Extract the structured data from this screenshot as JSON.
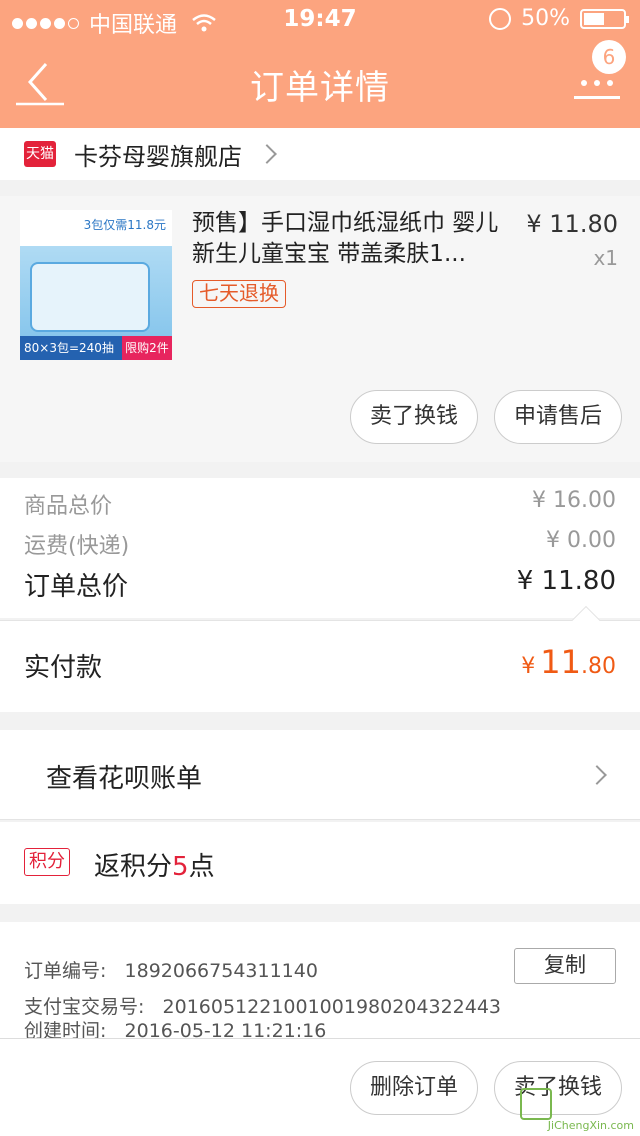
{
  "status_bar": {
    "carrier": "中国联通",
    "time": "19:47",
    "battery": "50%"
  },
  "nav": {
    "title": "订单详情",
    "badge": "6"
  },
  "store": {
    "platform_badge": "天猫",
    "name": "卡芬母婴旗舰店"
  },
  "product": {
    "title": "预售】手口湿巾纸湿纸巾 婴儿新生儿童宝宝 带盖柔肤1...",
    "price": "¥ 11.80",
    "quantity": "x1",
    "tag": "七天退换",
    "image_text": {
      "promo": "3包仅需11.8元",
      "pack_info": "80×3包=240抽",
      "limit": "限购2件"
    },
    "actions": {
      "sell": "卖了换钱",
      "after_sale": "申请售后"
    }
  },
  "totals": {
    "goods_label": "商品总价",
    "goods_value": "¥ 16.00",
    "shipping_label": "运费(快递)",
    "shipping_value": "¥ 0.00",
    "order_label": "订单总价",
    "order_value": "¥ 11.80",
    "paid_label": "实付款",
    "paid_currency": "¥",
    "paid_integer": "11",
    "paid_decimal": ".80"
  },
  "bill": {
    "label": "查看花呗账单"
  },
  "points": {
    "badge": "积分",
    "prefix": "返积分",
    "number": "5",
    "suffix": "点"
  },
  "order_info": {
    "order_no_label": "订单编号:",
    "order_no": "1892066754311140",
    "copy_label": "复制",
    "alipay_label": "支付宝交易号:",
    "alipay_no": "2016051221001001980204322443",
    "created_label": "创建时间:",
    "created_time": "2016-05-12 11:21:16"
  },
  "footer": {
    "delete": "删除订单",
    "sell": "卖了换钱",
    "watermark": "JiChengXin.com"
  },
  "colors": {
    "header": "#fca47f",
    "accent_orange": "#f05a14",
    "tmall_red": "#e3223a"
  }
}
